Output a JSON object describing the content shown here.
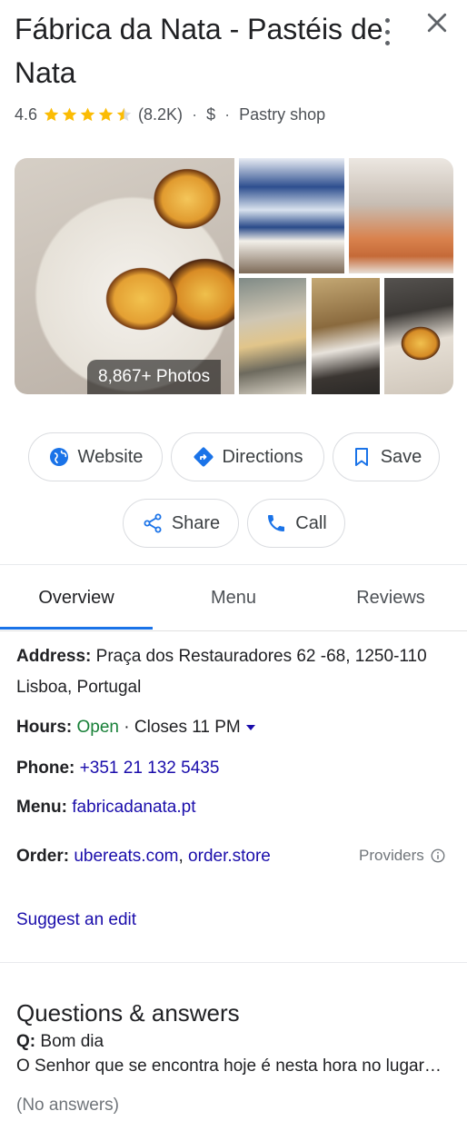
{
  "place": {
    "name": "Fábrica da Nata - Pastéis de Nata",
    "rating": "4.6",
    "stars": 4.5,
    "review_count": "(8.2K)",
    "price": "$",
    "category": "Pastry shop",
    "separator": "·"
  },
  "photos": {
    "count_label": "8,867+ Photos"
  },
  "actions": {
    "website": "Website",
    "directions": "Directions",
    "save": "Save",
    "share": "Share",
    "call": "Call"
  },
  "tabs": [
    {
      "label": "Overview",
      "active": true
    },
    {
      "label": "Menu",
      "active": false
    },
    {
      "label": "Reviews",
      "active": false
    }
  ],
  "details": {
    "address_label": "Address:",
    "address": "Praça dos Restauradores 62 -68, 1250-110 Lisboa, Portugal",
    "hours_label": "Hours:",
    "hours_status": "Open",
    "hours_sep": "·",
    "hours_close": "Closes 11 PM",
    "phone_label": "Phone:",
    "phone": "+351 21 132 5435",
    "menu_label": "Menu:",
    "menu": "fabricadanata.pt",
    "order_label": "Order:",
    "order_links": [
      "ubereats.com",
      "order.store"
    ],
    "order_comma": ",",
    "providers": "Providers",
    "suggest_edit": "Suggest an edit"
  },
  "qa": {
    "title": "Questions & answers",
    "q_label": "Q:",
    "question": "Bom dia",
    "question_body": "O Senhor que se encontra hoje é nesta hora no lugar do Pedro",
    "no_answers": "(No answers)"
  },
  "colors": {
    "accent": "#1a73e8",
    "link": "#1a0dab",
    "star": "#fbbc04",
    "open": "#188038"
  },
  "icons": {
    "more": "more-vertical-icon",
    "close": "close-icon",
    "website": "globe-icon",
    "directions": "directions-icon",
    "save": "bookmark-icon",
    "share": "share-icon",
    "call": "phone-icon",
    "info": "info-icon"
  }
}
